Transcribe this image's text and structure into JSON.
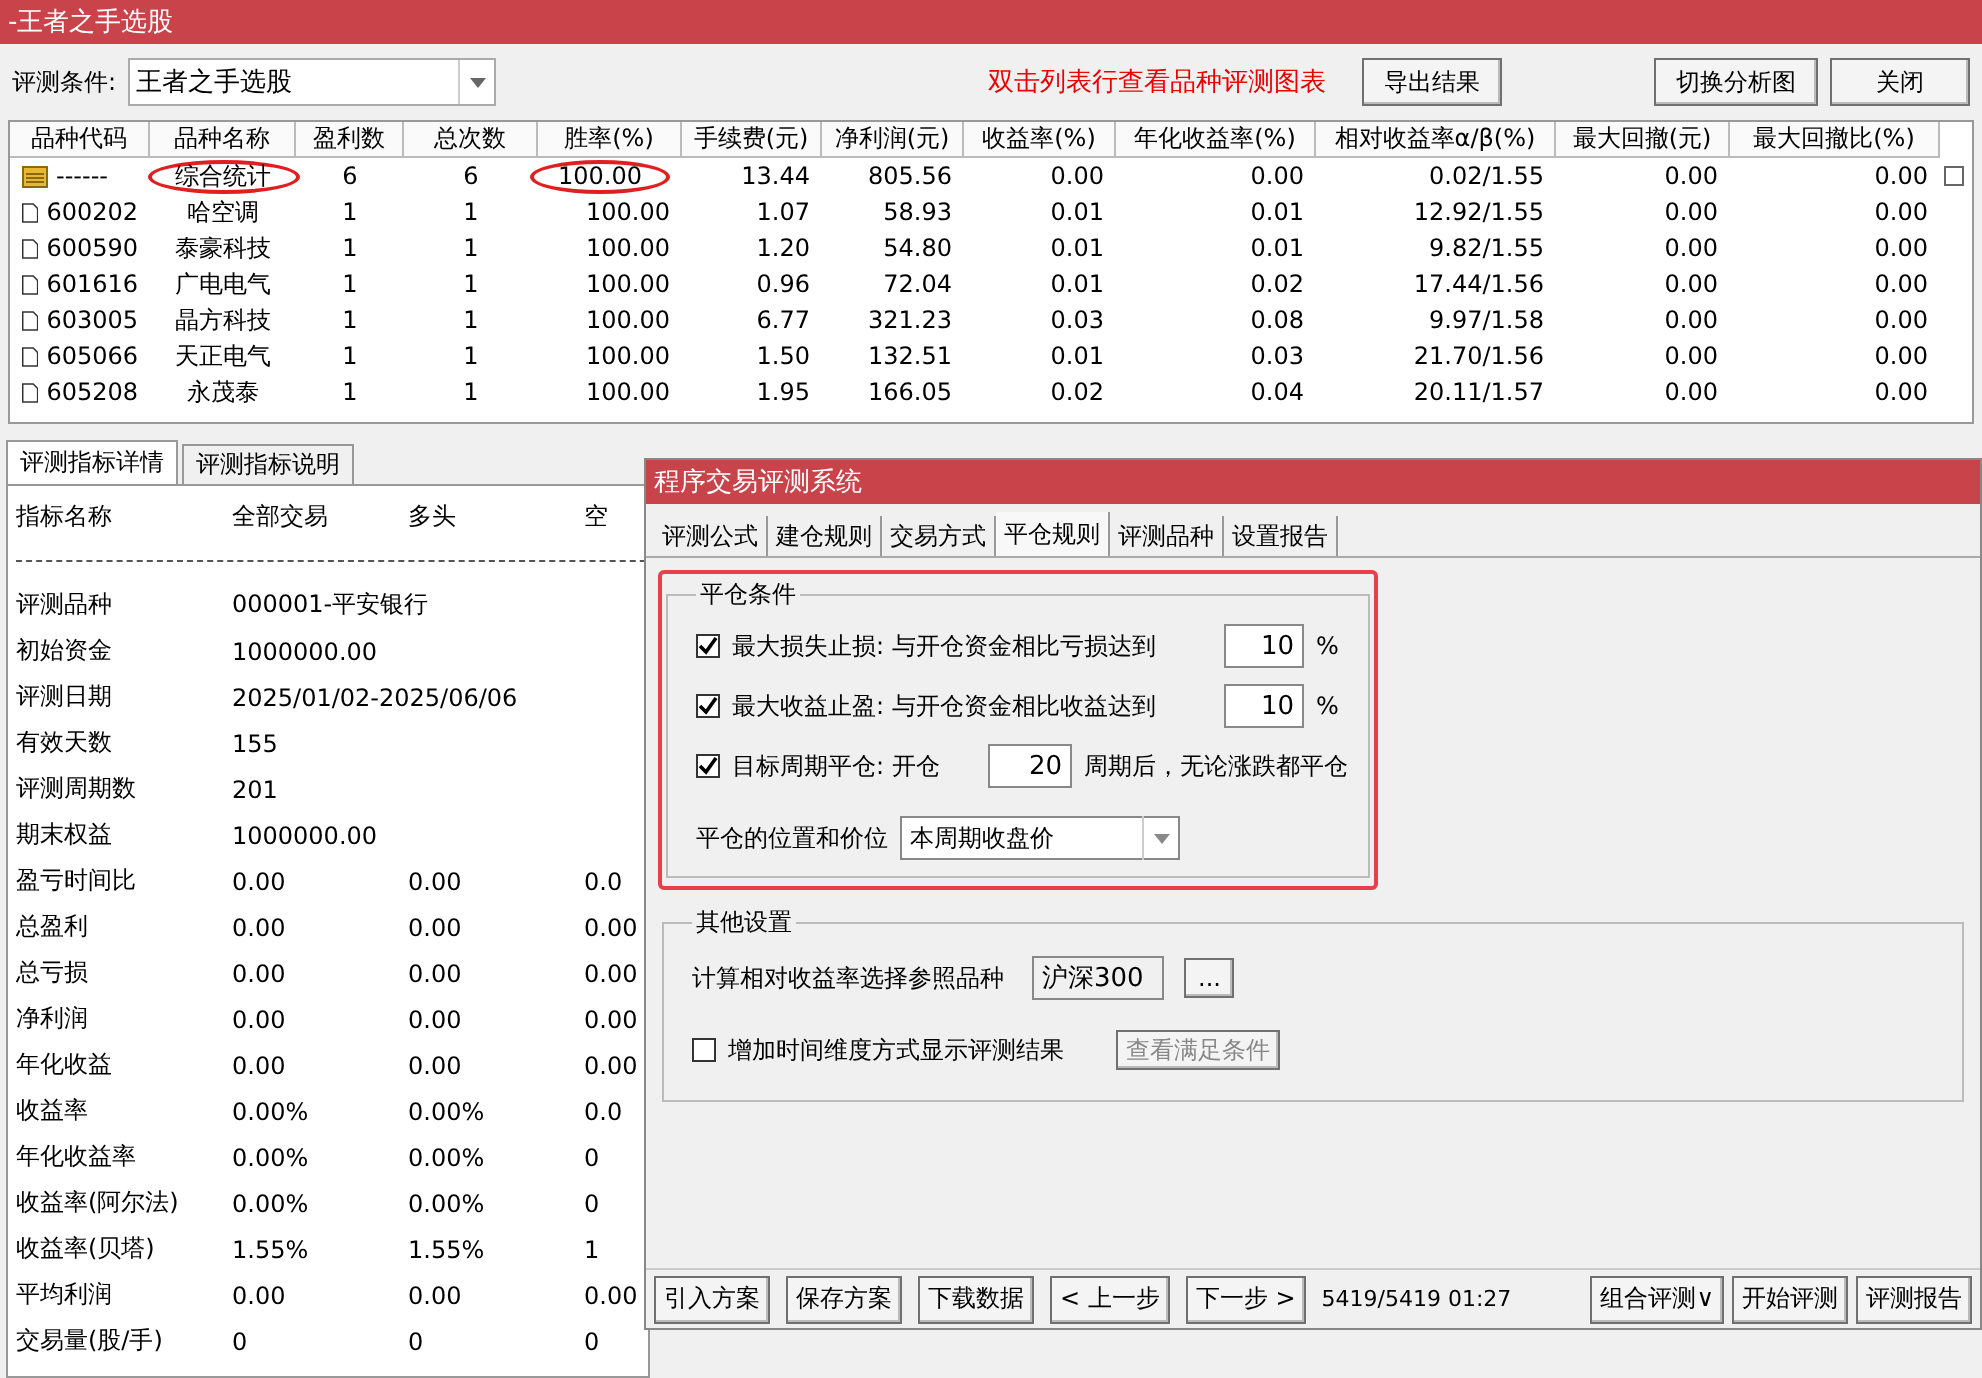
{
  "window": {
    "title": "-王者之手选股"
  },
  "toolbar": {
    "condition_label": "评测条件:",
    "condition_value": "王者之手选股",
    "hint": "双击列表行查看品种评测图表",
    "buttons": [
      "导出结果",
      "切换分析图",
      "关闭"
    ]
  },
  "table": {
    "columns": [
      "品种代码",
      "品种名称",
      "盈利数",
      "总次数",
      "胜率(%)",
      "手续费(元)",
      "净利润(元)",
      "收益率(%)",
      "年化收益率(%)",
      "相对收益率α/β(%)",
      "最大回撤(元)",
      "最大回撤比(%)"
    ],
    "rows": [
      {
        "kind": "summary",
        "name_circled": true,
        "rate_circled": true,
        "cells": [
          "------",
          "综合统计",
          "6",
          "6",
          "100.00",
          "13.44",
          "805.56",
          "0.00",
          "0.00",
          "0.02/1.55",
          "0.00",
          "0.00"
        ]
      },
      {
        "kind": "stock",
        "cells": [
          "600202",
          "哈空调",
          "1",
          "1",
          "100.00",
          "1.07",
          "58.93",
          "0.01",
          "0.01",
          "12.92/1.55",
          "0.00",
          "0.00"
        ]
      },
      {
        "kind": "stock",
        "cells": [
          "600590",
          "泰豪科技",
          "1",
          "1",
          "100.00",
          "1.20",
          "54.80",
          "0.01",
          "0.01",
          "9.82/1.55",
          "0.00",
          "0.00"
        ]
      },
      {
        "kind": "stock",
        "cells": [
          "601616",
          "广电电气",
          "1",
          "1",
          "100.00",
          "0.96",
          "72.04",
          "0.01",
          "0.02",
          "17.44/1.56",
          "0.00",
          "0.00"
        ]
      },
      {
        "kind": "stock",
        "cells": [
          "603005",
          "晶方科技",
          "1",
          "1",
          "100.00",
          "6.77",
          "321.23",
          "0.03",
          "0.08",
          "9.97/1.58",
          "0.00",
          "0.00"
        ]
      },
      {
        "kind": "stock",
        "cells": [
          "605066",
          "天正电气",
          "1",
          "1",
          "100.00",
          "1.50",
          "132.51",
          "0.01",
          "0.03",
          "21.70/1.56",
          "0.00",
          "0.00"
        ]
      },
      {
        "kind": "stock",
        "cells": [
          "605208",
          "永茂泰",
          "1",
          "1",
          "100.00",
          "1.95",
          "166.05",
          "0.02",
          "0.04",
          "20.11/1.57",
          "0.00",
          "0.00"
        ]
      }
    ]
  },
  "detail": {
    "tabs": [
      {
        "label": "评测指标详情",
        "selected": true
      },
      {
        "label": "评测指标说明",
        "selected": false
      }
    ],
    "header": [
      "指标名称",
      "全部交易",
      "多头",
      "空"
    ],
    "info": [
      {
        "name": "评测品种",
        "value": "000001-平安银行"
      },
      {
        "name": "初始资金",
        "value": "1000000.00"
      },
      {
        "name": "评测日期",
        "value": "2025/01/02-2025/06/06"
      },
      {
        "name": "有效天数",
        "value": "155"
      },
      {
        "name": "评测周期数",
        "value": "201"
      },
      {
        "name": "期末权益",
        "value": "1000000.00"
      }
    ],
    "metrics": [
      {
        "name": "盈亏时间比",
        "values": [
          "0.00",
          "0.00",
          "0.0"
        ]
      },
      {
        "name": "总盈利",
        "values": [
          "0.00",
          "0.00",
          "0.00"
        ]
      },
      {
        "name": "总亏损",
        "values": [
          "0.00",
          "0.00",
          "0.00"
        ]
      },
      {
        "name": "净利润",
        "values": [
          "0.00",
          "0.00",
          "0.00"
        ]
      },
      {
        "name": "年化收益",
        "values": [
          "0.00",
          "0.00",
          "0.00"
        ]
      },
      {
        "name": "收益率",
        "values": [
          "0.00%",
          "0.00%",
          "0.0"
        ]
      },
      {
        "name": "年化收益率",
        "values": [
          "0.00%",
          "0.00%",
          "0"
        ]
      },
      {
        "name": "收益率(阿尔法)",
        "values": [
          "0.00%",
          "0.00%",
          "0"
        ]
      },
      {
        "name": "收益率(贝塔)",
        "values": [
          "1.55%",
          "1.55%",
          "1"
        ]
      },
      {
        "name": "平均利润",
        "values": [
          "0.00",
          "0.00",
          "0.00"
        ]
      },
      {
        "name": "交易量(股/手)",
        "values": [
          "0",
          "0",
          "0"
        ]
      }
    ]
  },
  "dialog": {
    "title": "程序交易评测系统",
    "tabs": [
      {
        "label": "评测公式",
        "selected": false
      },
      {
        "label": "建仓规则",
        "selected": false
      },
      {
        "label": "交易方式",
        "selected": false
      },
      {
        "label": "平仓规则",
        "selected": true
      },
      {
        "label": "评测品种",
        "selected": false
      },
      {
        "label": "设置报告",
        "selected": false
      }
    ],
    "close_group": {
      "title": "平仓条件",
      "highlighted": true,
      "rules": [
        {
          "kind": "threshold",
          "checked": true,
          "label": "最大损失止损: 与开仓资金相比亏损达到",
          "value": "10",
          "unit": "%"
        },
        {
          "kind": "threshold",
          "checked": true,
          "label": "最大收益止盈: 与开仓资金相比收益达到",
          "value": "10",
          "unit": "%"
        },
        {
          "kind": "period",
          "checked": true,
          "label": "目标周期平仓: 开仓",
          "value": "20",
          "unit": "周期后，无论涨跌都平仓"
        }
      ],
      "position_label": "平仓的位置和价位",
      "position_value": "本周期收盘价"
    },
    "other_group": {
      "title": "其他设置",
      "reference_label": "计算相对收益率选择参照品种",
      "reference_value": "沪深300",
      "browse_button": "...",
      "time_dimension": {
        "label": "增加时间维度方式显示评测结果",
        "checked": false
      },
      "view_button": "查看满足条件"
    },
    "footer": {
      "buttons": [
        "引入方案",
        "保存方案",
        "下载数据",
        "< 上一步",
        "下一步 >"
      ],
      "status": "5419/5419 01:27",
      "right_buttons": [
        "组合评测∨",
        "开始评测",
        "评测报告"
      ]
    }
  }
}
